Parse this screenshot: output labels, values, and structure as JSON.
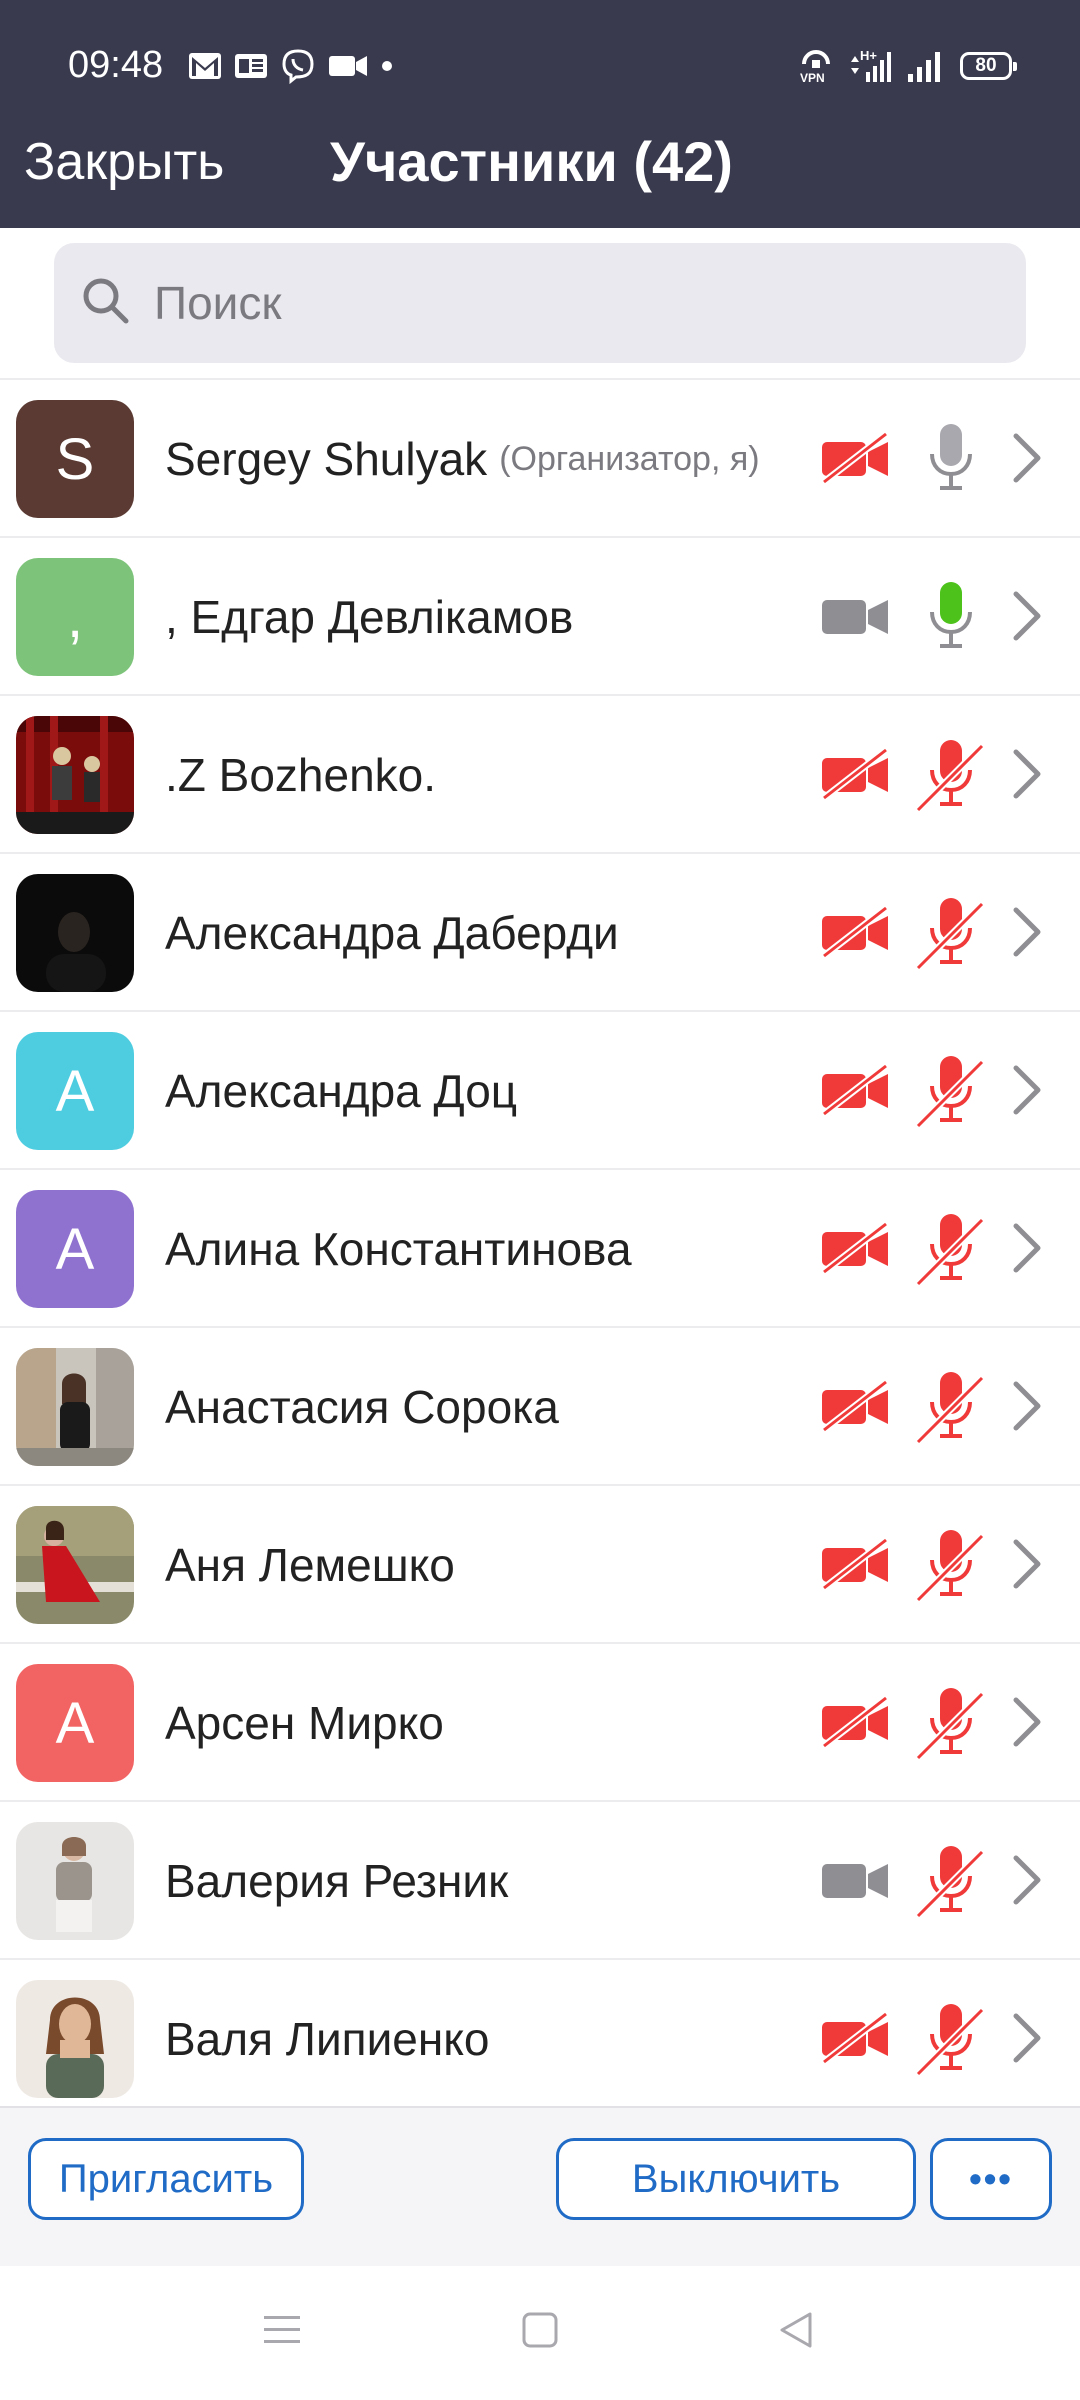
{
  "status_bar": {
    "time": "09:48",
    "battery": "80",
    "left_icons": [
      "gmail-icon",
      "news-icon",
      "viber-icon",
      "video-icon",
      "dot-icon"
    ],
    "right_icons": [
      "vpn-icon",
      "network-hplus-icon",
      "signal-icon",
      "signal-icon"
    ]
  },
  "header": {
    "close_label": "Закрыть",
    "title": "Участники (42)",
    "background": "#393a4e"
  },
  "search": {
    "placeholder": "Поиск"
  },
  "participants": [
    {
      "name": "Sergey Shulyak",
      "role": "(Организатор, я)",
      "avatar_letter": "S",
      "avatar_color": "#5a3a32",
      "video": "off",
      "audio": "idle"
    },
    {
      "name": ", Едгар Девлікамов",
      "avatar_letter": ",",
      "avatar_color": "#7dc47a",
      "video": "on",
      "audio": "speaking"
    },
    {
      "name": ".Z Bozhenko.",
      "avatar_photo": "theater-stage",
      "video": "off",
      "audio": "muted"
    },
    {
      "name": "Александра Даберди",
      "avatar_photo": "dark-portrait",
      "video": "off",
      "audio": "muted"
    },
    {
      "name": "Александра Доц",
      "avatar_letter": "A",
      "avatar_color": "#4fcde0",
      "video": "off",
      "audio": "muted"
    },
    {
      "name": "Алина Константинова",
      "avatar_letter": "A",
      "avatar_color": "#8f72cf",
      "video": "off",
      "audio": "muted"
    },
    {
      "name": "Анастасия Сорока",
      "avatar_photo": "street-portrait",
      "video": "off",
      "audio": "muted"
    },
    {
      "name": "Аня Лемешко",
      "avatar_photo": "red-dress-portrait",
      "video": "off",
      "audio": "muted"
    },
    {
      "name": "Арсен Мирко",
      "avatar_letter": "A",
      "avatar_color": "#f26464",
      "video": "off",
      "audio": "muted"
    },
    {
      "name": "Валерия Резник",
      "avatar_photo": "light-portrait",
      "video": "on",
      "audio": "muted"
    },
    {
      "name": "Валя Липиенко",
      "avatar_photo": "selfie-portrait",
      "video": "off",
      "audio": "muted"
    }
  ],
  "footer": {
    "invite_label": "Пригласить",
    "mute_all_label": "Выключить",
    "more_label": "•••",
    "accent": "#1f6bc6"
  },
  "nav": {
    "items": [
      "menu-icon",
      "home-icon",
      "back-icon"
    ]
  },
  "colors": {
    "muted_red": "#f03a3a",
    "active_green": "#4cc21a",
    "icon_grey": "#8e8e93"
  }
}
